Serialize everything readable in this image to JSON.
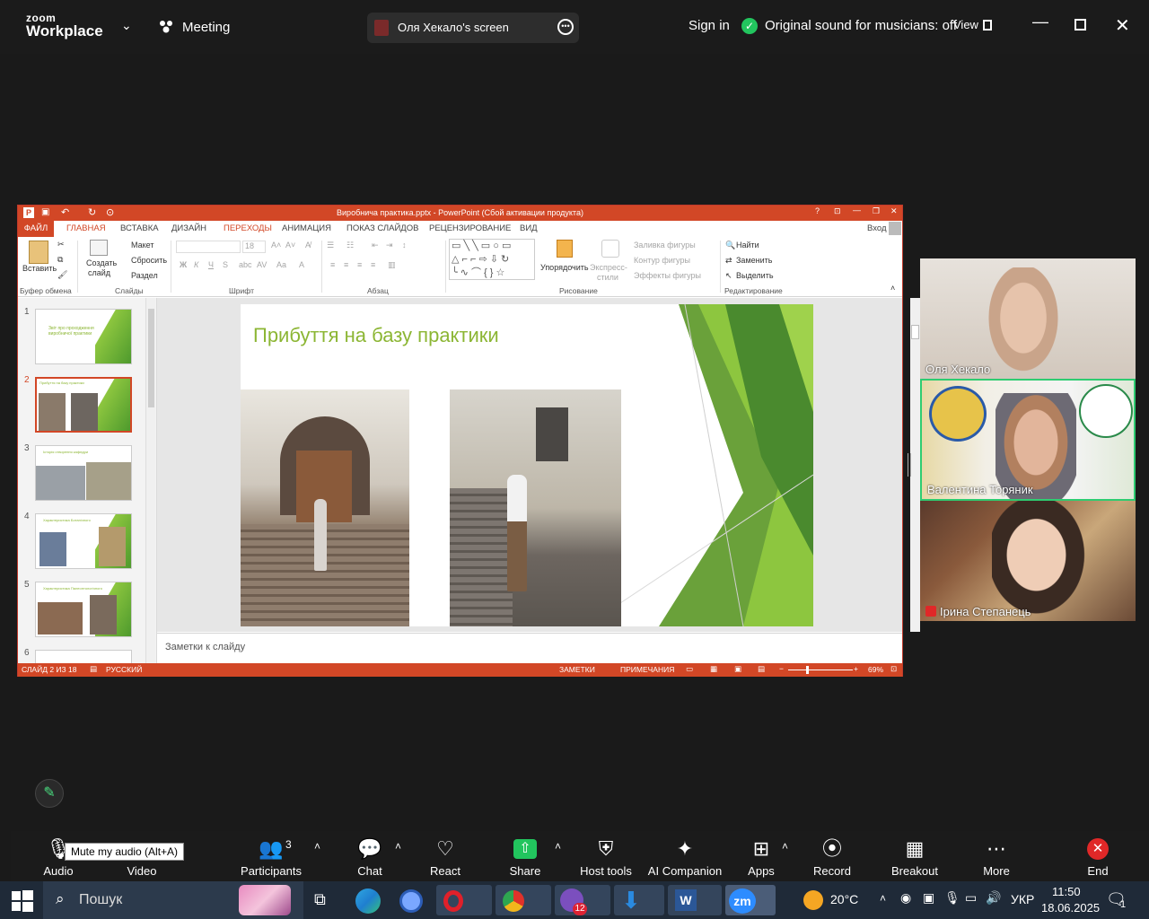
{
  "zoom": {
    "logo_line1": "zoom",
    "logo_line2": "Workplace",
    "meeting_label": "Meeting",
    "screen_share_label": "Оля Хекало's screen",
    "sign_in": "Sign in",
    "original_sound": "Original sound for musicians: off",
    "view": "View"
  },
  "ppt": {
    "title": "Виробнича практика.pptx - PowerPoint (Сбой активации продукта)",
    "signin": "Вход",
    "tabs": [
      "ФАЙЛ",
      "ГЛАВНАЯ",
      "ВСТАВКА",
      "ДИЗАЙН",
      "ПЕРЕХОДЫ",
      "АНИМАЦИЯ",
      "ПОКАЗ СЛАЙДОВ",
      "РЕЦЕНЗИРОВАНИЕ",
      "ВИД"
    ],
    "ribbon": {
      "paste": "Вставить",
      "create_slide_1": "Создать",
      "create_slide_2": "слайд",
      "layout": "Макет",
      "reset": "Сбросить",
      "section": "Раздел",
      "font_size": "18",
      "arrange": "Упорядочить",
      "express_1": "Экспресс-",
      "express_2": "стили",
      "shape_fill": "Заливка фигуры",
      "shape_outline": "Контур фигуры",
      "shape_effects": "Эффекты фигуры",
      "find": "Найти",
      "replace": "Заменить",
      "select": "Выделить",
      "groups": [
        "Буфер обмена",
        "Слайды",
        "Шрифт",
        "Абзац",
        "Рисование",
        "Редактирование"
      ]
    },
    "thumbnails": [
      {
        "num": "1",
        "text": "Звіт про проходження виробничої практики"
      },
      {
        "num": "2",
        "text": "Прибуття на базу практики"
      },
      {
        "num": "3",
        "text": "Історія створення кафедри"
      },
      {
        "num": "4",
        "text": "Характеристика Ботанічного"
      },
      {
        "num": "5",
        "text": "Характеристика Палеонтологічного"
      },
      {
        "num": "6",
        "text": ""
      }
    ],
    "slide_title": "Прибуття на базу практики",
    "notes_placeholder": "Заметки к слайду",
    "status": {
      "slide_count": "СЛАЙД 2 ИЗ 18",
      "language": "РУССКИЙ",
      "notes": "ЗАМЕТКИ",
      "comments": "ПРИМЕЧАНИЯ",
      "zoom": "69%"
    }
  },
  "participants_video": [
    {
      "name": "Оля Хекало"
    },
    {
      "name": "Валентина Торяник"
    },
    {
      "name": "Ірина Степанець"
    }
  ],
  "toolbar": {
    "tooltip": "Mute my audio (Alt+A)",
    "audio": "Audio",
    "video": "Video",
    "participants": "Participants",
    "participants_count": "3",
    "chat": "Chat",
    "react": "React",
    "share": "Share",
    "host_tools": "Host tools",
    "ai_companion": "AI Companion",
    "apps": "Apps",
    "record": "Record",
    "breakout": "Breakout rooms",
    "more": "More",
    "end": "End"
  },
  "taskbar": {
    "search": "Пошук",
    "weather": "20°C",
    "lang": "УКР",
    "time": "11:50",
    "date": "18.06.2025",
    "viber_badge": "12",
    "notif_count": "1"
  },
  "colors": {
    "ppt_accent": "#d24726",
    "slide_title": "#8cb634",
    "zoom_green": "#22c55e",
    "active_speaker": "#2ecc71",
    "end_red": "#e02828"
  }
}
